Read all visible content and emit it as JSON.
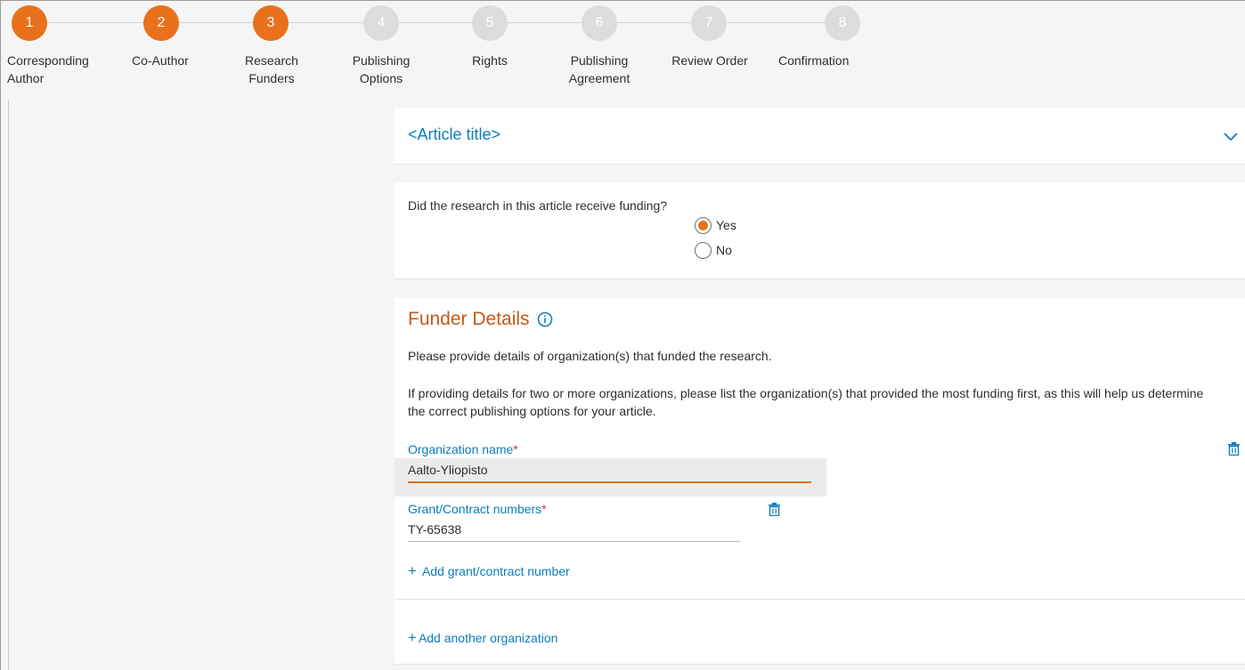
{
  "stepper": {
    "steps": [
      {
        "number": "1",
        "label": "Corresponding Author",
        "state": "done"
      },
      {
        "number": "2",
        "label": "Co-Author",
        "state": "done"
      },
      {
        "number": "3",
        "label": "Research Funders",
        "state": "current"
      },
      {
        "number": "4",
        "label": "Publishing Options",
        "state": "todo"
      },
      {
        "number": "5",
        "label": "Rights",
        "state": "todo"
      },
      {
        "number": "6",
        "label": "Publishing Agreement",
        "state": "todo"
      },
      {
        "number": "7",
        "label": "Review Order",
        "state": "todo"
      },
      {
        "number": "8",
        "label": "Confirmation",
        "state": "todo"
      }
    ]
  },
  "article": {
    "title": "<Article title>"
  },
  "funding": {
    "question": "Did the research in this article receive funding?",
    "options": [
      {
        "label": "Yes",
        "selected": true
      },
      {
        "label": "No",
        "selected": false
      }
    ]
  },
  "funder_details": {
    "heading": "Funder Details",
    "intro": "Please provide details of organization(s) that funded the research.",
    "instruction": "If providing details for two or more organizations, please list the organization(s) that provided the most funding first, as this will help us determine the correct publishing options for your article.",
    "org_label": "Organization name",
    "org_value": "Aalto-Yliopisto",
    "grant_label": "Grant/Contract numbers",
    "grant_value": "TY-65638",
    "required_mark": "*",
    "add_grant_label": "Add grant/contract number",
    "add_org_label": "Add another organization",
    "plus_glyph": "+"
  },
  "colors": {
    "accent_orange": "#e9711c",
    "link_blue": "#0c7dbb",
    "heading_orange": "#c45a18",
    "required_red": "#d72a2a"
  }
}
